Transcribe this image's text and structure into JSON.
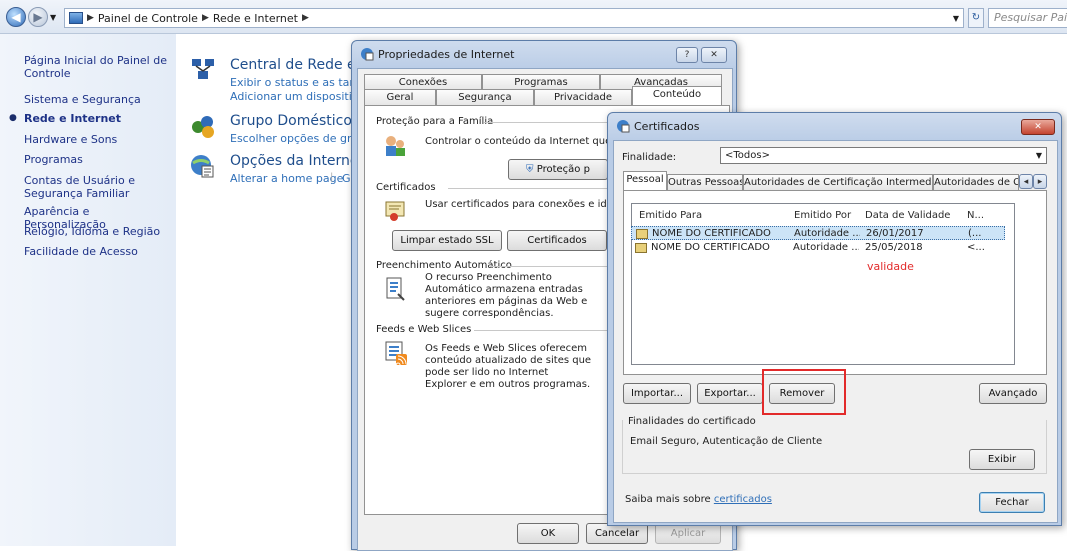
{
  "address_bar": {
    "crumbs": [
      "Painel de Controle",
      "Rede e Internet"
    ],
    "search_placeholder": "Pesquisar Painel"
  },
  "left_pane": {
    "items": [
      {
        "label": "Página Inicial do Painel de Controle"
      },
      {
        "label": "Sistema e Segurança"
      },
      {
        "label": "Rede e Internet",
        "current": true
      },
      {
        "label": "Hardware e Sons"
      },
      {
        "label": "Programas"
      },
      {
        "label": "Contas de Usuário e Segurança Familiar"
      },
      {
        "label": "Aparência e Personalização"
      },
      {
        "label": "Relógio, Idioma e Região"
      },
      {
        "label": "Facilidade de Acesso"
      }
    ]
  },
  "categories": [
    {
      "title": "Central de Rede e C",
      "links": [
        "Exibir o status e as tarefas",
        "Adicionar um dispositivo s"
      ]
    },
    {
      "title": "Grupo Doméstico",
      "links": [
        "Escolher opções de grupo"
      ]
    },
    {
      "title": "Opções da Internet",
      "links": [
        "Alterar a home page",
        "G"
      ]
    }
  ],
  "internet_props": {
    "title": "Propriedades de Internet",
    "help_btn": "?",
    "close_btn": "✕",
    "tabs_top": [
      "Conexões",
      "Programas",
      "Avançadas"
    ],
    "tabs_bottom": [
      "Geral",
      "Segurança",
      "Privacidade",
      "Conteúdo"
    ],
    "family": {
      "label": "Proteção para a Família",
      "text": "Controlar o conteúdo da Internet que pode",
      "button": "Proteção p"
    },
    "certs": {
      "label": "Certificados",
      "text": "Usar certificados para conexões e identifica",
      "btn_ssl": "Limpar estado SSL",
      "btn_certs": "Certificados"
    },
    "autofill": {
      "label": "Preenchimento Automático",
      "text": "O recurso Preenchimento Automático armazena entradas anteriores em páginas da Web e sugere correspondências."
    },
    "feeds": {
      "label": "Feeds e Web Slices",
      "text": "Os Feeds e Web Slices oferecem conteúdo atualizado de sites que pode ser lido no Internet Explorer e em outros programas."
    },
    "ok": "OK",
    "cancel": "Cancelar",
    "apply": "Aplicar"
  },
  "certificados": {
    "title": "Certificados",
    "close_btn": "✕",
    "finalidade_label": "Finalidade:",
    "finalidade_value": "<Todos>",
    "tabs": [
      "Pessoal",
      "Outras Pessoas",
      "Autoridades de Certificação Intermediárias",
      "Autoridades de Ce"
    ],
    "scroll_left": "◂",
    "scroll_right": "▸",
    "columns": [
      "Emitido Para",
      "Emitido Por",
      "Data de Validade",
      "N..."
    ],
    "rows": [
      {
        "to": "NOME DO CERTIFICADO",
        "by": "Autoridade ...",
        "date": "26/01/2017",
        "name": "(...",
        "selected": true
      },
      {
        "to": "NOME DO CERTIFICADO",
        "by": "Autoridade ...",
        "date": "25/05/2018",
        "name": "<..."
      }
    ],
    "annotation": "validade",
    "btn_import": "Importar...",
    "btn_export": "Exportar...",
    "btn_remove": "Remover",
    "btn_advanced": "Avançado",
    "purposes_label": "Finalidades do certificado",
    "purposes_value": "Email Seguro, Autenticação de Cliente",
    "btn_view": "Exibir",
    "learn_more_prefix": "Saiba mais sobre ",
    "learn_more_link": "certificados",
    "btn_close": "Fechar"
  },
  "colors": {
    "link": "#2f6fb8",
    "annotation_red": "#e22a2a"
  }
}
